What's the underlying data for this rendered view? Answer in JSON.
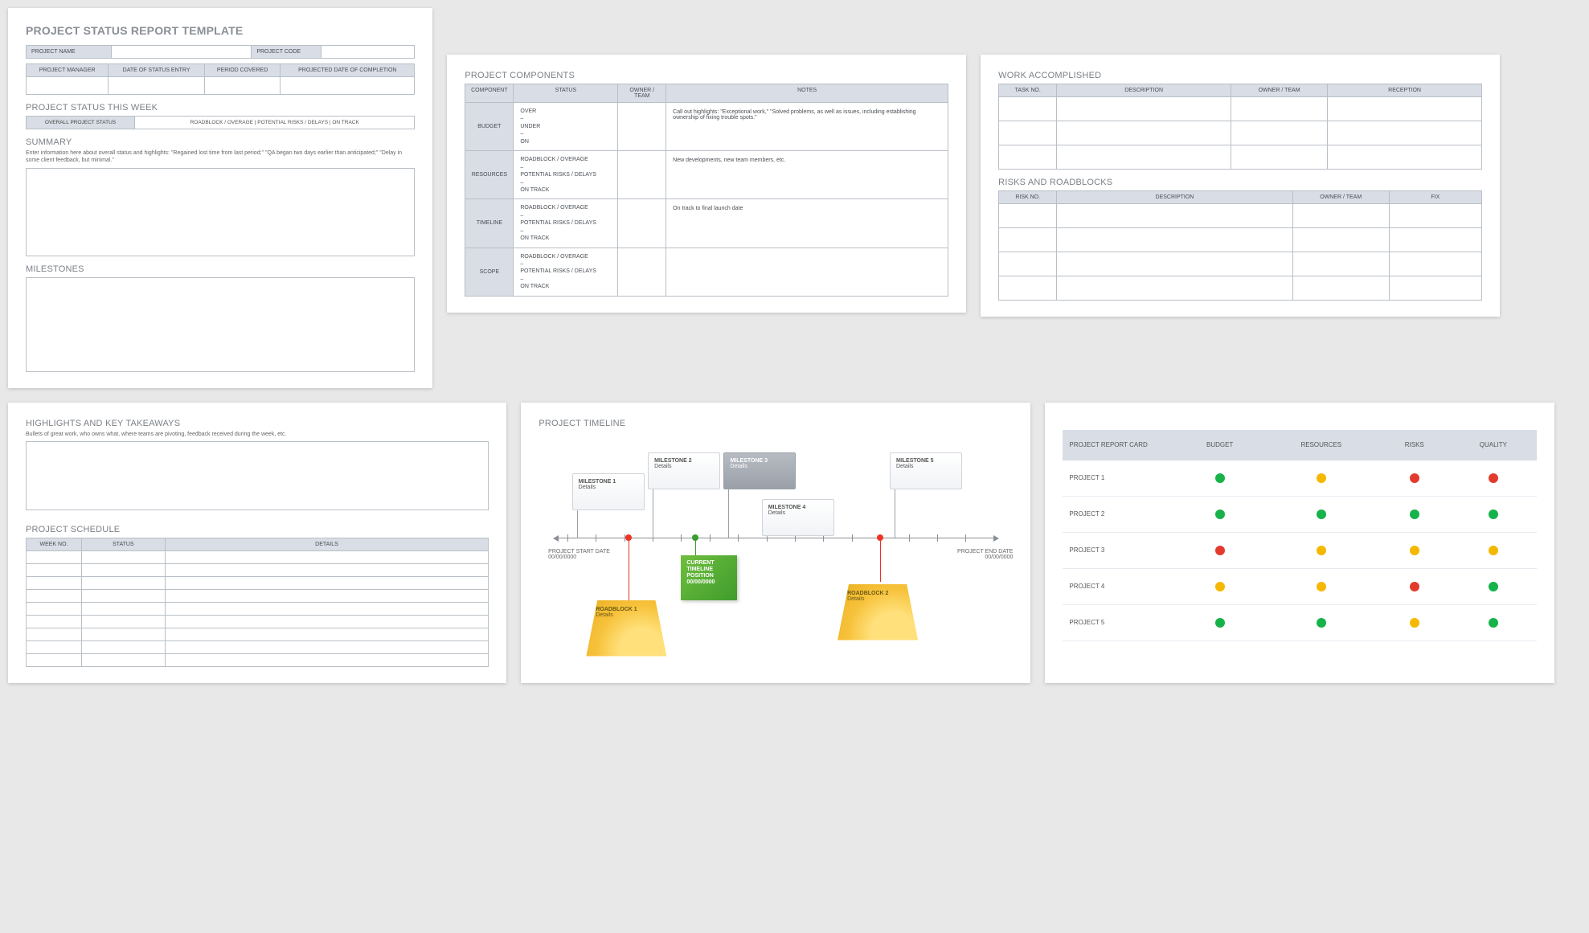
{
  "page1": {
    "title": "PROJECT STATUS REPORT TEMPLATE",
    "fields": {
      "project_name": "PROJECT NAME",
      "project_code": "PROJECT CODE",
      "project_manager": "PROJECT MANAGER",
      "date_of_status_entry": "DATE OF STATUS ENTRY",
      "period_covered": "PERIOD COVERED",
      "projected_date_of_completion": "PROJECTED DATE OF COMPLETION"
    },
    "status_week_heading": "PROJECT STATUS THIS WEEK",
    "status_bar_label": "OVERALL PROJECT STATUS",
    "status_bar_options": "ROADBLOCK / OVERAGE   |   POTENTIAL RISKS / DELAYS   |   ON TRACK",
    "summary_heading": "SUMMARY",
    "summary_hint": "Enter information here about overall status and highlights: \"Regained lost time from last period;\" \"QA began two days earlier than anticipated;\" \"Delay in some client feedback, but minimal.\"",
    "milestones_heading": "MILESTONES"
  },
  "page2": {
    "heading": "PROJECT COMPONENTS",
    "headers": {
      "component": "COMPONENT",
      "status": "STATUS",
      "owner": "OWNER / TEAM",
      "notes": "NOTES"
    },
    "rows": [
      {
        "label": "BUDGET",
        "status": "OVER\n–\nUNDER\n–\nON",
        "notes": "Call out highlights: \"Exceptional work,\" \"Solved problems, as well as issues, including establishing ownership of fixing trouble spots.\""
      },
      {
        "label": "RESOURCES",
        "status": "ROADBLOCK / OVERAGE\n–\nPOTENTIAL RISKS / DELAYS\n–\nON TRACK",
        "notes": "New developments, new team members, etc."
      },
      {
        "label": "TIMELINE",
        "status": "ROADBLOCK / OVERAGE\n–\nPOTENTIAL RISKS / DELAYS\n–\nON TRACK",
        "notes": "On track to final launch date"
      },
      {
        "label": "SCOPE",
        "status": "ROADBLOCK / OVERAGE\n–\nPOTENTIAL RISKS / DELAYS\n–\nON TRACK",
        "notes": ""
      }
    ]
  },
  "page3": {
    "work_heading": "WORK ACCOMPLISHED",
    "work_headers": {
      "task": "TASK NO.",
      "desc": "DESCRIPTION",
      "owner": "OWNER / TEAM",
      "reception": "RECEPTION"
    },
    "risks_heading": "RISKS AND ROADBLOCKS",
    "risks_headers": {
      "risk": "RISK NO.",
      "desc": "DESCRIPTION",
      "owner": "OWNER / TEAM",
      "fix": "FIX"
    }
  },
  "page4": {
    "highlights_heading": "HIGHLIGHTS AND KEY TAKEAWAYS",
    "highlights_hint": "Bullets of great work, who owns what, where teams are pivoting, feedback received during the week, etc.",
    "schedule_heading": "PROJECT SCHEDULE",
    "schedule_headers": {
      "week": "WEEK NO.",
      "status": "STATUS",
      "details": "DETAILS"
    }
  },
  "page5": {
    "heading": "PROJECT TIMELINE",
    "milestones": [
      {
        "title": "MILESTONE 1",
        "sub": "Details"
      },
      {
        "title": "MILESTONE 2",
        "sub": "Details"
      },
      {
        "title": "MILESTONE 3",
        "sub": "Details"
      },
      {
        "title": "MILESTONE 4",
        "sub": "Details"
      },
      {
        "title": "MILESTONE 5",
        "sub": "Details"
      }
    ],
    "start_label": "PROJECT START DATE",
    "start_date": "00/00/0000",
    "end_label": "PROJECT END DATE",
    "end_date": "00/00/0000",
    "current_label": "CURRENT TIMELINE POSITION",
    "current_date": "00/00/0000",
    "roadblocks": [
      {
        "title": "ROADBLOCK 1",
        "sub": "Details"
      },
      {
        "title": "ROADBLOCK 2",
        "sub": "Details"
      }
    ]
  },
  "page6": {
    "headers": {
      "first": "PROJECT REPORT CARD",
      "c1": "BUDGET",
      "c2": "RESOURCES",
      "c3": "RISKS",
      "c4": "QUALITY"
    },
    "rows": [
      {
        "name": "PROJECT 1",
        "cells": [
          "g",
          "y",
          "r",
          "r"
        ]
      },
      {
        "name": "PROJECT 2",
        "cells": [
          "g",
          "g",
          "g",
          "g"
        ]
      },
      {
        "name": "PROJECT 3",
        "cells": [
          "r",
          "y",
          "y",
          "y"
        ]
      },
      {
        "name": "PROJECT 4",
        "cells": [
          "y",
          "y",
          "r",
          "g"
        ]
      },
      {
        "name": "PROJECT 5",
        "cells": [
          "g",
          "g",
          "y",
          "g"
        ]
      }
    ]
  }
}
